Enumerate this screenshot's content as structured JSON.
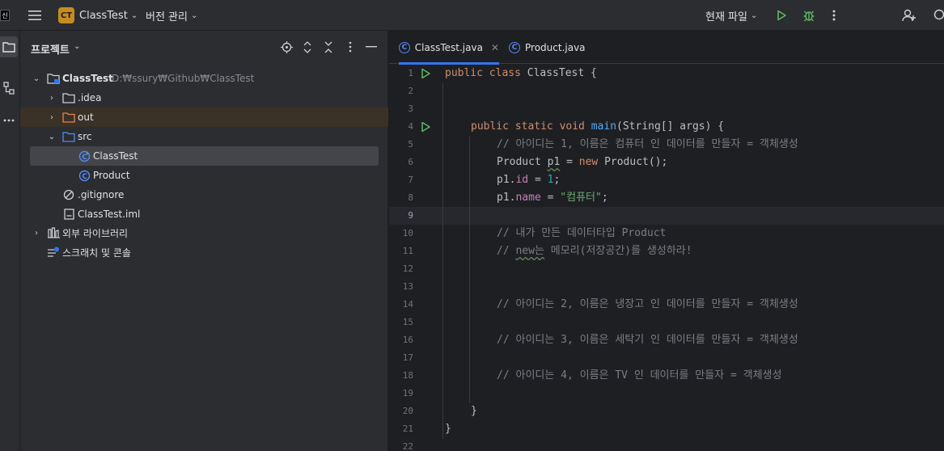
{
  "titlebar": {
    "project_badge": "CT",
    "project_name": "ClassTest",
    "vcs_label": "버전 관리",
    "run_config": "현재 파일"
  },
  "project_panel": {
    "title": "프로젝트",
    "tree": [
      {
        "label": "ClassTest",
        "path": "D:₩ssury₩Github₩ClassTest",
        "icon": "module-folder-icon"
      },
      {
        "label": ".idea",
        "icon": "folder-icon"
      },
      {
        "label": "out",
        "icon": "excluded-folder-icon"
      },
      {
        "label": "src",
        "icon": "source-folder-icon"
      },
      {
        "label": "ClassTest",
        "icon": "java-class-main-icon"
      },
      {
        "label": "Product",
        "icon": "java-class-icon"
      },
      {
        "label": ".gitignore",
        "icon": "ignore-file-icon"
      },
      {
        "label": "ClassTest.iml",
        "icon": "iml-file-icon"
      },
      {
        "label": "외부 라이브러리",
        "icon": "libraries-icon"
      },
      {
        "label": "스크래치 및 콘솔",
        "icon": "scratches-icon"
      }
    ]
  },
  "editor": {
    "tabs": [
      {
        "label": "ClassTest.java",
        "active": true
      },
      {
        "label": "Product.java",
        "active": false
      }
    ],
    "line_numbers": [
      "1",
      "2",
      "3",
      "4",
      "5",
      "6",
      "7",
      "8",
      "9",
      "10",
      "11",
      "12",
      "13",
      "14",
      "15",
      "16",
      "17",
      "18",
      "19",
      "20",
      "21",
      "22"
    ],
    "code": {
      "l1_kw": "public class ",
      "l1_name": "ClassTest {",
      "l4_kw": "public static void ",
      "l4_fn": "main",
      "l4_rest": "(String[] args) {",
      "l5": "// 아이디는 1, 이름은 컴퓨터 인 데이터를 만들자 = 객체생성",
      "l6_a": "Product ",
      "l6_var": "p1",
      "l6_b": " = ",
      "l6_kw": "new",
      "l6_c": " Product();",
      "l7_a": "p1.",
      "l7_fld": "id",
      "l7_b": " = ",
      "l7_num": "1",
      "l7_c": ";",
      "l8_a": "p1.",
      "l8_fld": "name",
      "l8_b": " = ",
      "l8_str": "\"컴퓨터\"",
      "l8_c": ";",
      "l10": "// 내가 만든 데이터타입 Product",
      "l11_a": "// ",
      "l11_new": "new는",
      "l11_b": " 메모리(저장공간)를 생성하라!",
      "l14": "// 아이디는 2, 이름은 냉장고 인 데이터를 만들자 = 객체생성",
      "l16": "// 아이디는 3, 이름은 세탁기 인 데이터를 만들자 = 객체생성",
      "l18": "// 아이디는 4, 이름은 TV 인 데이터를 만들자 = 객체생성",
      "l20": "}",
      "l21": "}"
    }
  },
  "colors": {
    "accent": "#3574f0",
    "keyword": "#cf8e6d",
    "function": "#56a8f5",
    "comment": "#7a7e85",
    "string": "#6aab73",
    "number": "#2aacb8",
    "field": "#c77dbb",
    "run_green": "#5fb865",
    "badge": "#c88b1f"
  }
}
